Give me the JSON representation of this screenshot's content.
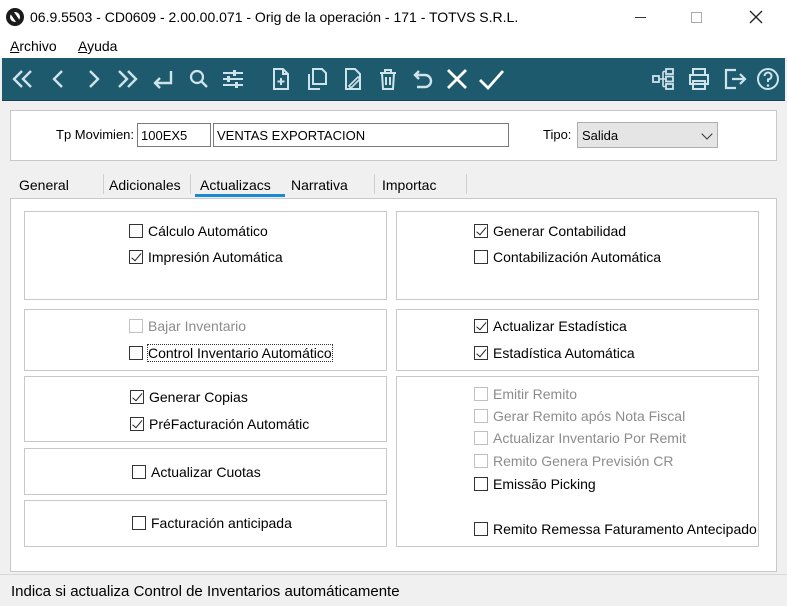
{
  "window": {
    "title": "06.9.5503 - CD0609 - 2.00.00.071 - Orig de la operación - 171 - TOTVS S.R.L."
  },
  "menu": {
    "archivo": {
      "underline": "A",
      "rest": "rchivo"
    },
    "ayuda": {
      "underline": "A",
      "rest": "yuda"
    }
  },
  "toolbar_icons": [
    "first-record-icon",
    "previous-record-icon",
    "next-record-icon",
    "last-record-icon",
    "return-icon",
    "search-icon",
    "filter-icon",
    "new-document-icon",
    "copy-icon",
    "edit-icon",
    "delete-icon",
    "undo-icon",
    "cancel-icon",
    "confirm-icon",
    "hierarchy-icon",
    "print-icon",
    "exit-icon",
    "help-icon"
  ],
  "header": {
    "tp_movimiento_label": "Tp Movimien:",
    "tp_movimiento_code": "100EX5",
    "tp_movimiento_desc": "VENTAS EXPORTACION",
    "tipo_label": "Tipo:",
    "tipo_value": "Salida"
  },
  "tabs": {
    "general": "General",
    "adicionales": "Adicionales",
    "actualizacs": "Actualizacs",
    "narrativa": "Narrativa",
    "importac": "Importac"
  },
  "left": {
    "calculo_automatico": "Cálculo Automático",
    "impresion_automatica": "Impresión Automática",
    "bajar_inventario": "Bajar Inventario",
    "control_inventario_automatico": "Control Inventario Automático",
    "generar_copias": "Generar Copias",
    "prefacturacion_automatic": "PréFacturación Automátic",
    "actualizar_cuotas": "Actualizar Cuotas",
    "facturacion_anticipada": "Facturación anticipada"
  },
  "right": {
    "generar_contabilidad": "Generar Contabilidad",
    "contabilizacion_automatica": "Contabilización Automática",
    "actualizar_estadistica": "Actualizar Estadística",
    "estadistica_automatica": "Estadística Automática",
    "emitir_remito": "Emitir Remito",
    "gerar_remito_apos_nota_fiscal": "Gerar Remito após Nota Fiscal",
    "actualizar_inventario_por_remito": "Actualizar Inventario Por Remit",
    "remito_genera_prevision_cr": "Remito Genera Previsión CR",
    "emissao_picking": "Emissão Picking",
    "remito_remessa_faturamento_antecipado": "Remito Remessa Faturamento Antecipado"
  },
  "status": {
    "message": "Indica si actualiza Control de Inventarios automáticamente"
  },
  "colors": {
    "toolbar_bg": "#1e5a6d",
    "tab_active_underline": "#1a8ad4",
    "disabled_text": "#8c8c8c"
  }
}
